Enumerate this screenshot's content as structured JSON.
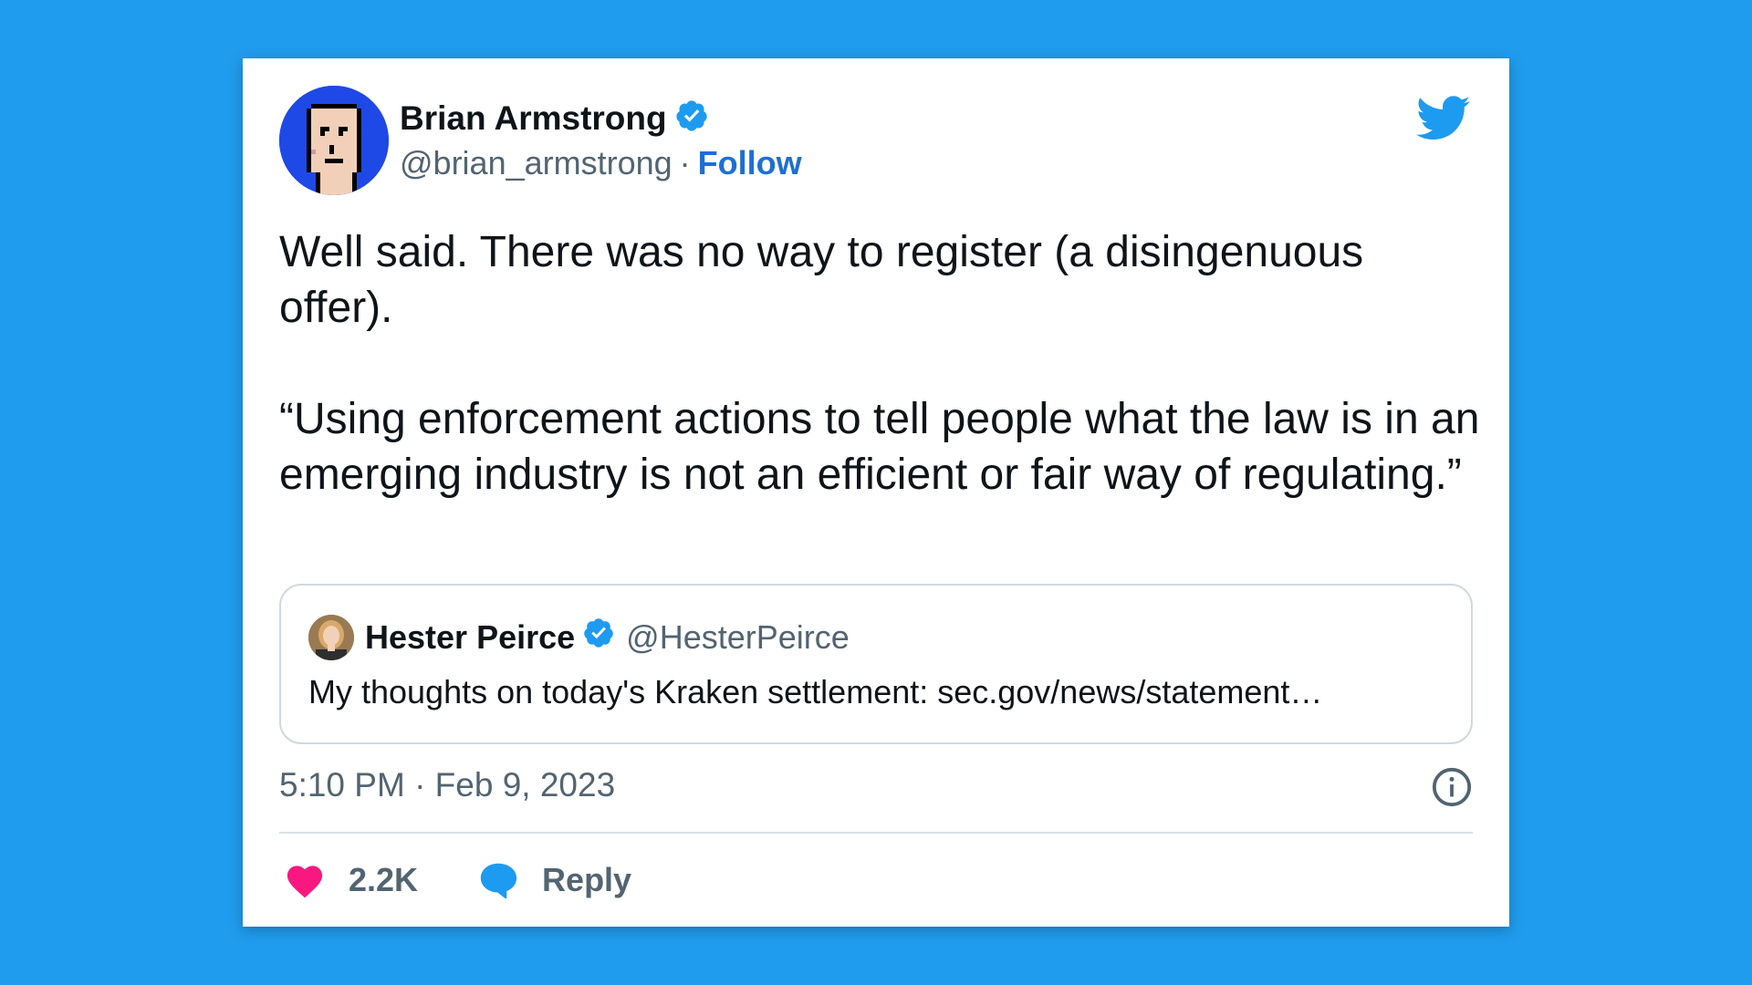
{
  "author": {
    "name": "Brian Armstrong",
    "handle": "@brian_armstrong",
    "separator": "·",
    "follow_label": "Follow"
  },
  "tweet": {
    "paragraphs": [
      "Well said. There was no way to register (a disingenuous offer).",
      "“Using enforcement actions to tell people what the law is in an emerging industry is not an efficient or fair way of regulating.”"
    ],
    "timestamp": "5:10 PM · Feb 9, 2023"
  },
  "quoted_tweet": {
    "name": "Hester Peirce",
    "handle": "@HesterPeirce",
    "text": "My thoughts on today's Kraken settlement: sec.gov/news/statement…"
  },
  "actions": {
    "like_count": "2.2K",
    "reply_label": "Reply"
  },
  "icons": {
    "verified": "verified-badge-icon",
    "brand": "twitter-bird-icon",
    "info": "info-icon",
    "like": "heart-icon",
    "reply": "reply-bubble-icon"
  },
  "colors": {
    "background": "#209cee",
    "link": "#1d6fd6",
    "verified": "#1d9bf0",
    "heart": "#f91880"
  }
}
